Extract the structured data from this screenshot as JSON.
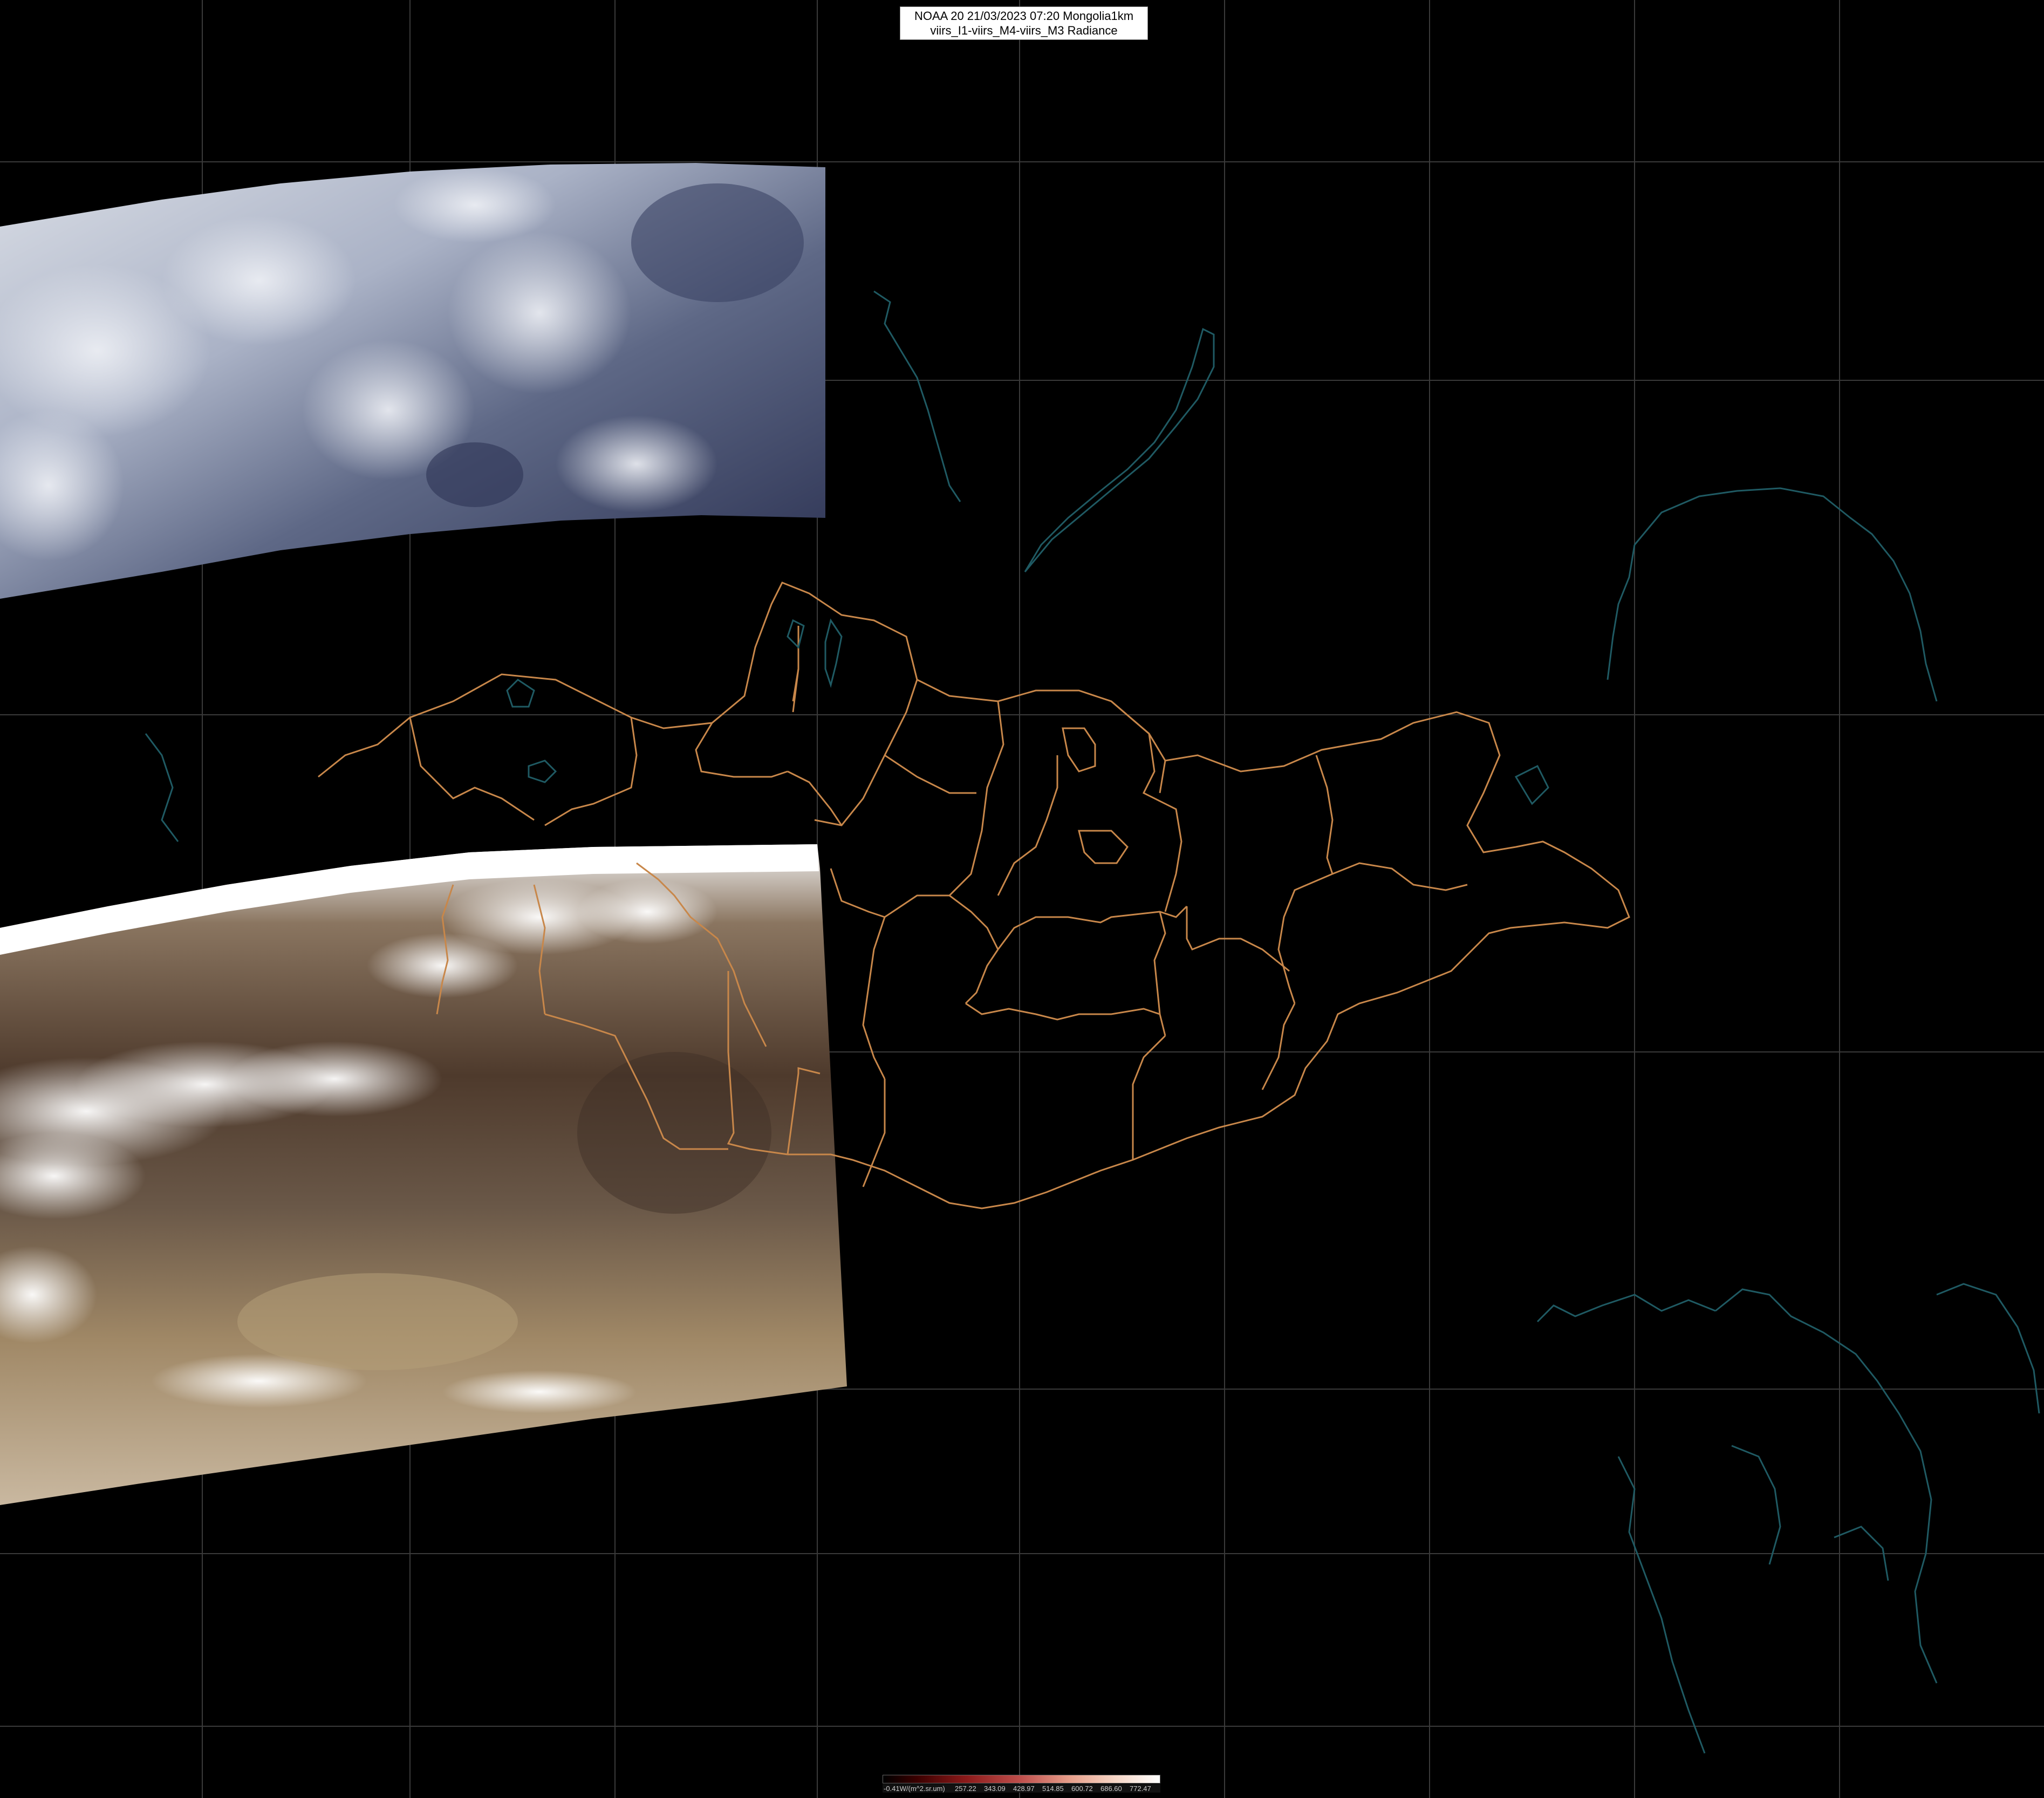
{
  "header": {
    "title_line1": "NOAA 20 21/03/2023 07:20 Mongolia1km",
    "title_line2": "viirs_I1-viirs_M4-viirs_M3 Radiance"
  },
  "colorbar": {
    "labels": [
      "-0.41W/(m^2.sr.um)",
      "257.22",
      "343.09",
      "428.97",
      "514.85",
      "600.72",
      "686.60",
      "772.47"
    ]
  },
  "colors": {
    "background": "#000000",
    "gridline": "#3a3a3a",
    "province_border": "#c8874a",
    "coastline": "#1f5a63"
  }
}
